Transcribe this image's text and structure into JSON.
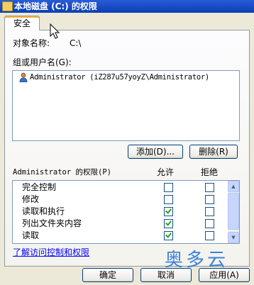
{
  "window": {
    "title": "本地磁盘 (C:) 的权限"
  },
  "tabs": [
    {
      "label": "安全"
    }
  ],
  "object": {
    "label": "对象名称:",
    "value": "C:\\"
  },
  "groups": {
    "label": "组或用户名(G):",
    "items": [
      {
        "name": "Administrator (iZ287u57yoyZ\\Administrator)",
        "icon": "user-icon"
      }
    ]
  },
  "buttons": {
    "add": "添加(D)...",
    "remove": "删除(R)",
    "ok": "确定",
    "cancel": "取消",
    "apply": "应用(A)"
  },
  "permissions": {
    "header": "Administrator 的权限(P)",
    "allow_header": "允许",
    "deny_header": "拒绝",
    "items": [
      {
        "name": "完全控制",
        "allow": false,
        "deny": false
      },
      {
        "name": "修改",
        "allow": false,
        "deny": false
      },
      {
        "name": "读取和执行",
        "allow": true,
        "deny": false
      },
      {
        "name": "列出文件夹内容",
        "allow": true,
        "deny": false
      },
      {
        "name": "读取",
        "allow": true,
        "deny": false
      }
    ]
  },
  "help_link": "了解访问控制和权限",
  "watermark": "奥多云",
  "colors": {
    "titlebar": "#0a3fb4",
    "link": "#0000ff",
    "check": "#21a121"
  }
}
